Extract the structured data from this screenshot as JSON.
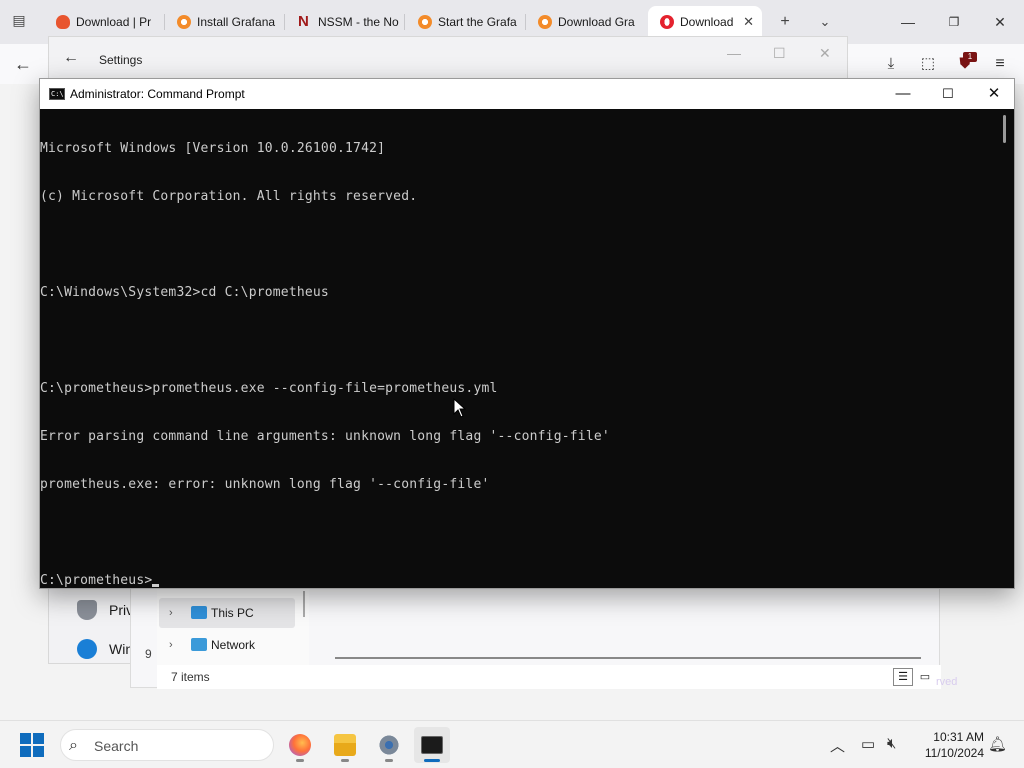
{
  "browser": {
    "tabs": [
      {
        "label": "Download | Pr",
        "favicon": "flame-icon",
        "active": false
      },
      {
        "label": "Install Grafana",
        "favicon": "grafana-icon",
        "active": false
      },
      {
        "label": "NSSM - the No",
        "favicon": "nssm-icon",
        "active": false
      },
      {
        "label": "Start the Grafa",
        "favicon": "grafana-icon",
        "active": false
      },
      {
        "label": "Download Gra",
        "favicon": "grafana-icon",
        "active": false
      },
      {
        "label": "Download",
        "favicon": "opera-icon",
        "active": true
      }
    ],
    "extension_badge": "1"
  },
  "settings": {
    "title": "Settings",
    "nav_items": [
      {
        "label": "Priv",
        "icon": "shield-icon"
      },
      {
        "label": "Win",
        "icon": "windows-update-icon"
      }
    ]
  },
  "explorer": {
    "nav_items": [
      {
        "label": "This PC",
        "icon": "monitor-icon",
        "selected": true
      },
      {
        "label": "Network",
        "icon": "network-icon",
        "selected": false
      }
    ],
    "item_count_partial": "9",
    "status_text": "7 items"
  },
  "cmd": {
    "title": "Administrator: Command Prompt",
    "lines": [
      "Microsoft Windows [Version 10.0.26100.1742]",
      "(c) Microsoft Corporation. All rights reserved.",
      "",
      "C:\\Windows\\System32>cd C:\\prometheus",
      "",
      "C:\\prometheus>prometheus.exe --config-file=prometheus.yml",
      "Error parsing command line arguments: unknown long flag '--config-file'",
      "prometheus.exe: error: unknown long flag '--config-file'",
      ""
    ],
    "prompt": "C:\\prometheus>"
  },
  "taskbar": {
    "search_placeholder": "Search",
    "time": "10:31 AM",
    "date": "11/10/2024",
    "apps": [
      "firefox-icon",
      "file-explorer-icon",
      "settings-gear-icon",
      "command-prompt-icon"
    ]
  },
  "colors": {
    "terminal_bg": "#0c0c0c",
    "terminal_fg": "#cccccc",
    "accent": "#0f6cbd"
  }
}
